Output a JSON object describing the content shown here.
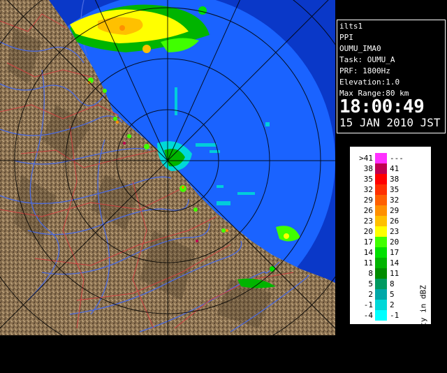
{
  "display": {
    "site": "ilts1",
    "product": "PPI",
    "scan": "OUMU_IMA0",
    "task": "Task: OUMU_A",
    "prf": "PRF: 1800Hz",
    "elevation": "Elevation:1.0",
    "max_range": "Max Range:80 km",
    "time": "18:00:49",
    "date": "15 JAN 2010 JST"
  },
  "legend": {
    "unit_label": "Reflectivity in dBZ",
    "rows": [
      {
        "lo": ">41",
        "hi": "---",
        "color": "#ff30ff"
      },
      {
        "lo": "38",
        "hi": "41",
        "color": "#c00050"
      },
      {
        "lo": "35",
        "hi": "38",
        "color": "#ff0000"
      },
      {
        "lo": "32",
        "hi": "35",
        "color": "#ff3000"
      },
      {
        "lo": "29",
        "hi": "32",
        "color": "#ff6000"
      },
      {
        "lo": "26",
        "hi": "29",
        "color": "#ff9000"
      },
      {
        "lo": "23",
        "hi": "26",
        "color": "#ffc000"
      },
      {
        "lo": "20",
        "hi": "23",
        "color": "#ffff00"
      },
      {
        "lo": "17",
        "hi": "20",
        "color": "#40ff00"
      },
      {
        "lo": "14",
        "hi": "17",
        "color": "#00e000"
      },
      {
        "lo": "11",
        "hi": "14",
        "color": "#00b400"
      },
      {
        "lo": "8",
        "hi": "11",
        "color": "#008c00"
      },
      {
        "lo": "5",
        "hi": "8",
        "color": "#009a60"
      },
      {
        "lo": "2",
        "hi": "5",
        "color": "#00a8a8"
      },
      {
        "lo": "-1",
        "hi": "2",
        "color": "#00d8d8"
      },
      {
        "lo": "-4",
        "hi": "-1",
        "color": "#00ffff"
      }
    ]
  },
  "colors": {
    "ocean_in_range": "#1a63ff",
    "ocean_out_range": "#0a38c8",
    "land": "#8a7050",
    "river": "#4a6ae0",
    "border": "#d04040",
    "range_ring": "#000000"
  }
}
